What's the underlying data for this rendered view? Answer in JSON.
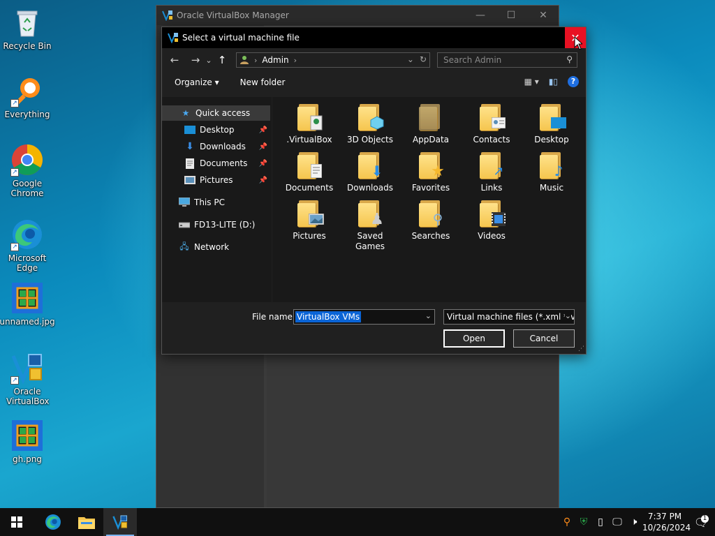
{
  "desktop": {
    "icons": [
      {
        "label": "Recycle Bin",
        "icon": "recycle-bin-icon"
      },
      {
        "label": "Everything",
        "icon": "everything-search-icon"
      },
      {
        "label": "Google Chrome",
        "icon": "chrome-icon"
      },
      {
        "label": "Microsoft Edge",
        "icon": "edge-icon"
      },
      {
        "label": "unnamed.jpg",
        "icon": "image-file-icon"
      },
      {
        "label": "Oracle VirtualBox",
        "icon": "virtualbox-icon"
      },
      {
        "label": "gh.png",
        "icon": "image-file-icon"
      }
    ]
  },
  "vbox_window": {
    "title": "Oracle VirtualBox Manager",
    "controls": {
      "minimize": "—",
      "maximize": "☐",
      "close": "✕"
    }
  },
  "dialog": {
    "title": "Select a virtual machine file",
    "close_glyph": "✕",
    "nav": {
      "back": "←",
      "forward": "→",
      "recent": "⌄",
      "up": "↑"
    },
    "address": {
      "segments": [
        "Admin"
      ],
      "separator": "›"
    },
    "search_placeholder": "Search Admin",
    "toolbar": {
      "organize": "Organize ▾",
      "new_folder": "New folder",
      "help": "?"
    },
    "nav_pane": {
      "quick_access": "Quick access",
      "pinned": [
        {
          "label": "Desktop",
          "icon": "desktop-icon"
        },
        {
          "label": "Downloads",
          "icon": "downloads-icon"
        },
        {
          "label": "Documents",
          "icon": "documents-icon"
        },
        {
          "label": "Pictures",
          "icon": "pictures-icon"
        }
      ],
      "this_pc": "This PC",
      "drive": "FD13-LITE (D:)",
      "network": "Network"
    },
    "folders": [
      {
        "label": ".VirtualBox",
        "icon": "virtualbox-folder-icon"
      },
      {
        "label": "3D Objects",
        "icon": "3d-objects-folder-icon"
      },
      {
        "label": "AppData",
        "icon": "appdata-folder-icon"
      },
      {
        "label": "Contacts",
        "icon": "contacts-folder-icon"
      },
      {
        "label": "Desktop",
        "icon": "desktop-folder-icon"
      },
      {
        "label": "Documents",
        "icon": "documents-folder-icon"
      },
      {
        "label": "Downloads",
        "icon": "downloads-folder-icon"
      },
      {
        "label": "Favorites",
        "icon": "favorites-folder-icon"
      },
      {
        "label": "Links",
        "icon": "links-folder-icon"
      },
      {
        "label": "Music",
        "icon": "music-folder-icon"
      },
      {
        "label": "Pictures",
        "icon": "pictures-folder-icon"
      },
      {
        "label": "Saved Games",
        "icon": "saved-games-folder-icon"
      },
      {
        "label": "Searches",
        "icon": "searches-folder-icon"
      },
      {
        "label": "Videos",
        "icon": "videos-folder-icon"
      }
    ],
    "file_name_label": "File name:",
    "file_name_value": "VirtualBox VMs",
    "file_type": "Virtual machine files (*.xml *.vbox)",
    "open_button": "Open",
    "cancel_button": "Cancel"
  },
  "taskbar": {
    "clock_time": "7:37 PM",
    "clock_date": "10/26/2024",
    "notification_count": "1"
  },
  "colors": {
    "accent": "#0a64d6",
    "close_red": "#e81123",
    "folder": "#f5c54e"
  }
}
